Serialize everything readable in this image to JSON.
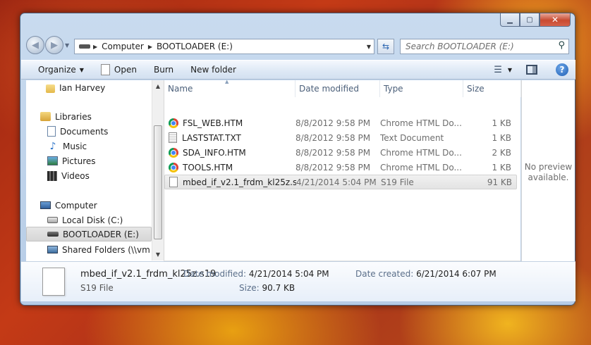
{
  "window": {
    "min_icon": "minimize-icon",
    "max_icon": "maximize-icon",
    "close_icon": "close-icon"
  },
  "address": {
    "segments": [
      "Computer",
      "BOOTLOADER (E:)"
    ]
  },
  "search": {
    "placeholder": "Search BOOTLOADER (E:)"
  },
  "toolbar": {
    "organize": "Organize",
    "open": "Open",
    "burn": "Burn",
    "new_folder": "New folder"
  },
  "nav": {
    "items": [
      {
        "label": "Ian Harvey"
      },
      {
        "label": "Libraries"
      },
      {
        "label": "Documents"
      },
      {
        "label": "Music"
      },
      {
        "label": "Pictures"
      },
      {
        "label": "Videos"
      },
      {
        "label": "Computer"
      },
      {
        "label": "Local Disk (C:)"
      },
      {
        "label": "BOOTLOADER (E:)"
      },
      {
        "label": "Shared Folders (\\\\vm"
      }
    ]
  },
  "columns": {
    "name": "Name",
    "date": "Date modified",
    "type": "Type",
    "size": "Size"
  },
  "files": [
    {
      "name": "FSL_WEB.HTM",
      "date": "8/8/2012 9:58 PM",
      "type": "Chrome HTML Do...",
      "size": "1 KB",
      "icon": "chrome-icon"
    },
    {
      "name": "LASTSTAT.TXT",
      "date": "8/8/2012 9:58 PM",
      "type": "Text Document",
      "size": "1 KB",
      "icon": "text-file-icon"
    },
    {
      "name": "SDA_INFO.HTM",
      "date": "8/8/2012 9:58 PM",
      "type": "Chrome HTML Do...",
      "size": "2 KB",
      "icon": "chrome-icon"
    },
    {
      "name": "TOOLS.HTM",
      "date": "8/8/2012 9:58 PM",
      "type": "Chrome HTML Do...",
      "size": "1 KB",
      "icon": "chrome-icon"
    },
    {
      "name": "mbed_if_v2.1_frdm_kl25z.s19",
      "date": "4/21/2014 5:04 PM",
      "type": "S19 File",
      "size": "91 KB",
      "icon": "blank-file-icon"
    }
  ],
  "preview": {
    "line1": "No preview",
    "line2": "available."
  },
  "details": {
    "name": "mbed_if_v2.1_frdm_kl25z.s19",
    "type": "S19 File",
    "date_modified_label": "Date modified:",
    "date_modified": "4/21/2014 5:04 PM",
    "date_created_label": "Date created:",
    "date_created": "6/21/2014 6:07 PM",
    "size_label": "Size:",
    "size": "90.7 KB"
  }
}
